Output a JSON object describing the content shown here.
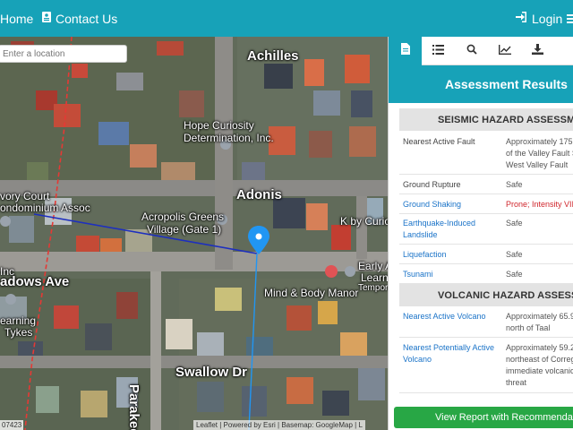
{
  "nav": {
    "home": "Home",
    "contact": "Contact Us",
    "login": "Login"
  },
  "map": {
    "search_placeholder": "Enter a location",
    "labels": {
      "achilles": "Achilles",
      "hope": "Hope Curiosity",
      "hope2": "Determination, Inc.",
      "adonis": "Adonis",
      "acropolis": "Acropolis Greens",
      "acropolis2": "Village (Gate 1)",
      "kby": "K by Curio",
      "early": "Early Adv",
      "learning": "Learning",
      "temporary": "Tempora",
      "mindbody": "Mind & Body Manor",
      "ivory": "vory Court",
      "condo": "ondominium Assoc",
      "inc": "Inc",
      "meadows": "adows Ave",
      "learning2": "earning",
      "tykes": "Tykes",
      "swallow": "Swallow Dr",
      "parakeet": "Parakeet"
    },
    "attribution": "Leaflet | Powered by Esri | Basemap: GoogleMap | L",
    "scale_num": "07423"
  },
  "colors": {
    "accent": "#17a2b8",
    "danger": "#d0272d",
    "link": "#1a73c8",
    "success": "#28a745",
    "pin": "#2196f3",
    "fault_line": "#e53935",
    "route_line": "#1d2fbf"
  },
  "tabs": [
    {
      "icon": "document-icon"
    },
    {
      "icon": "list-icon"
    },
    {
      "icon": "search-icon"
    },
    {
      "icon": "chart-icon"
    },
    {
      "icon": "download-icon"
    }
  ],
  "results": {
    "title": "Assessment Results",
    "seismic_title": "SEISMIC HAZARD ASSESSMENT",
    "seismic": [
      {
        "key": "Nearest Active Fault",
        "value": [
          "Approximately 175 r",
          "of the Valley Fault S",
          "West Valley Fault"
        ]
      },
      {
        "key": "Ground Rupture",
        "value": [
          "Safe"
        ]
      },
      {
        "key": "Ground Shaking",
        "value": [
          "Prone; Intensity VIII"
        ]
      },
      {
        "key": "Earthquake-Induced Landslide",
        "key_lines": [
          "Earthquake-Induced",
          "Landslide"
        ],
        "value": [
          "Safe"
        ]
      },
      {
        "key": "Liquefaction",
        "value": [
          "Safe"
        ]
      },
      {
        "key": "Tsunami",
        "value": [
          "Safe"
        ]
      }
    ],
    "volcanic_title": "VOLCANIC HAZARD ASSESSMENT",
    "volcanic": [
      {
        "key": "Nearest Active Volcano",
        "value": [
          "Approximately 65.9",
          "north of Taal"
        ]
      },
      {
        "key": "Nearest Potentially Active Volcano",
        "key_lines": [
          "Nearest Potentially Active",
          "Volcano"
        ],
        "value": [
          "Approximately 59.2",
          "northeast of Corregi",
          "immediate volcanic",
          "threat"
        ]
      }
    ],
    "report_button": "View Report with Recommendations"
  }
}
